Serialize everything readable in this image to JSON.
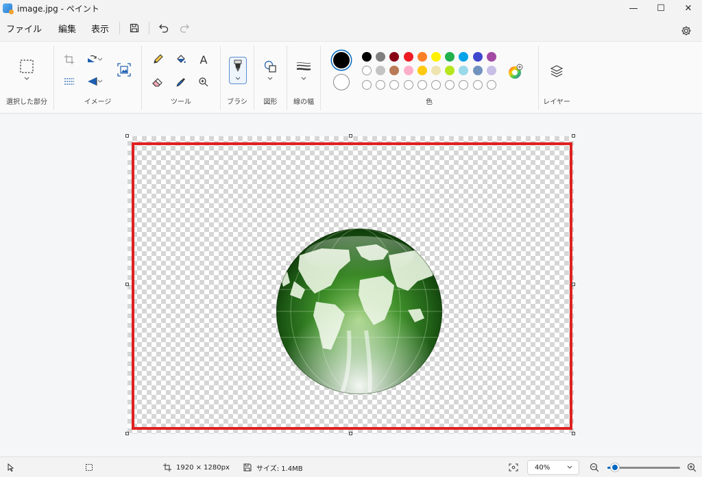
{
  "window": {
    "title": "image.jpg - ペイント",
    "controls": {
      "minimize": "—",
      "maximize": "☐",
      "close": "✕"
    }
  },
  "menu": {
    "items": [
      {
        "id": "file",
        "label": "ファイル"
      },
      {
        "id": "edit",
        "label": "編集"
      },
      {
        "id": "view",
        "label": "表示"
      }
    ],
    "icons": [
      "save-icon",
      "undo-icon",
      "redo-icon",
      "settings-gear-icon"
    ]
  },
  "ribbon": {
    "groups": {
      "selection": "選択した部分",
      "image": "イメージ",
      "tools": "ツール",
      "brushes": "ブラシ",
      "shapes": "図形",
      "stroke_width": "線の幅",
      "colors": "色",
      "layers": "レイヤー"
    },
    "tools_text_glyph": "A",
    "colors": {
      "primary": "#000000",
      "secondary": "#ffffff",
      "row1": [
        "#000000",
        "#7f7f7f",
        "#880015",
        "#ed1c24",
        "#ff7f27",
        "#fff200",
        "#22b14c",
        "#00a2e8",
        "#3f48cc",
        "#a349a4"
      ],
      "row2": [
        "#ffffff",
        "#c3c3c3",
        "#b97a57",
        "#ffaec9",
        "#ffc90e",
        "#efe4b0",
        "#b5e61d",
        "#99d9ea",
        "#7092be",
        "#c8bfe7"
      ],
      "row3_empty_count": 10
    }
  },
  "canvas": {
    "image": "green-glass-globe",
    "selection_color": "#e02020"
  },
  "status": {
    "dimensions": "1920 × 1280px",
    "size": "サイズ: 1.4MB",
    "zoom": "40%",
    "zoom_level": 0.1
  }
}
